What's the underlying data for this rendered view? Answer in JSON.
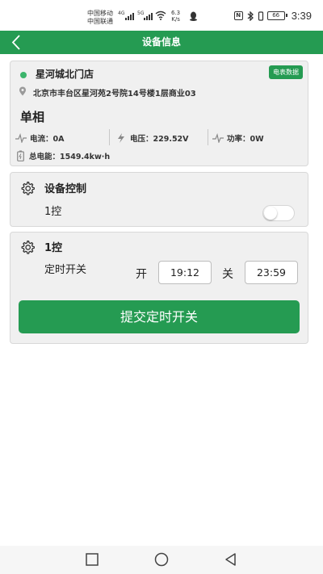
{
  "status_bar": {
    "carrier_1": "中国移动",
    "carrier_2": "中国联通",
    "network_1": "4G",
    "network_2": "5G",
    "speed_value": "6.3",
    "speed_unit": "K/s",
    "nfc_label": "N",
    "battery_level": "66",
    "time": "3:39"
  },
  "app_bar": {
    "title": "设备信息",
    "back_icon": "chevron-left-icon"
  },
  "device": {
    "store_name": "星河城北门店",
    "meter_button": "电表数据",
    "address": "北京市丰台区星河苑2号院14号楼1层商业03",
    "phase": "单相",
    "current": "电流：0A",
    "voltage": "电压：229.52V",
    "power": "功率：0W",
    "total_energy": "总电能：1549.4kw·h",
    "online_color": "#3cb56c"
  },
  "control": {
    "title": "设备控制",
    "channel_label": "1控",
    "switch_on": false
  },
  "timer": {
    "title": "1控",
    "label": "定时开关",
    "on_label": "开",
    "on_time": "19:12",
    "off_label": "关",
    "off_time": "23:59",
    "submit_label": "提交定时开关"
  },
  "nav_bar": {
    "items": [
      "recent-apps-square-icon",
      "home-circle-icon",
      "back-triangle-icon"
    ]
  },
  "colors": {
    "primary": "#259b52",
    "card_bg": "#f0f0f0"
  }
}
